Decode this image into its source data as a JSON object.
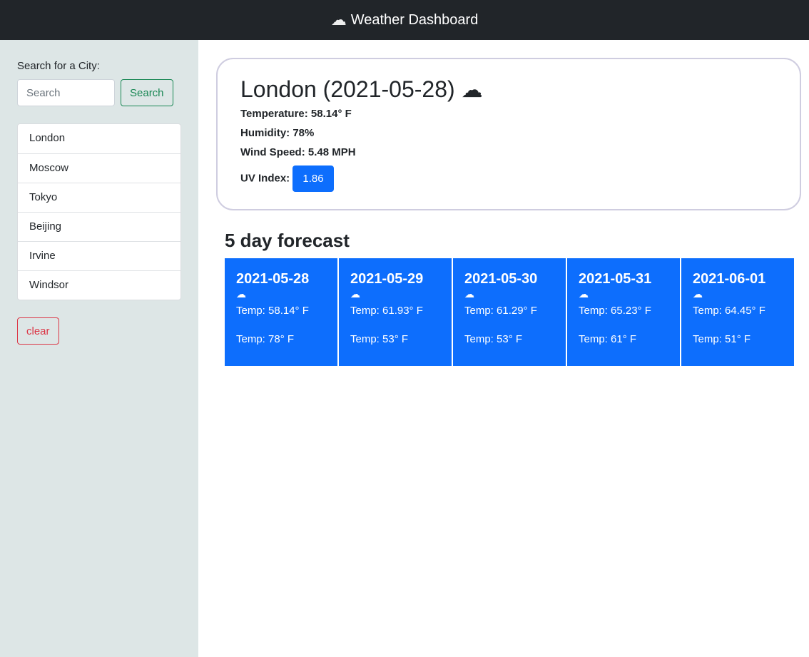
{
  "header": {
    "title": "Weather Dashboard",
    "icon": "cloud-icon"
  },
  "sidebar": {
    "label": "Search for a City:",
    "search_placeholder": "Search",
    "search_button": "Search",
    "cities": [
      "London",
      "Moscow",
      "Tokyo",
      "Beijing",
      "Irvine",
      "Windsor"
    ],
    "clear_button": "clear"
  },
  "current": {
    "title": "London (2021-05-28)",
    "icon": "cloud-icon",
    "temperature": "Temperature: 58.14° F",
    "humidity": "Humidity: 78%",
    "wind": "Wind Speed: 5.48 MPH",
    "uv_label": "UV Index:",
    "uv_value": "1.86",
    "uv_color": "#0d6efd"
  },
  "forecast": {
    "heading": "5 day forecast",
    "days": [
      {
        "date": "2021-05-28",
        "temp": "Temp: 58.14° F",
        "second": "Temp: 78° F"
      },
      {
        "date": "2021-05-29",
        "temp": "Temp: 61.93° F",
        "second": "Temp: 53° F"
      },
      {
        "date": "2021-05-30",
        "temp": "Temp: 61.29° F",
        "second": "Temp: 53° F"
      },
      {
        "date": "2021-05-31",
        "temp": "Temp: 65.23° F",
        "second": "Temp: 61° F"
      },
      {
        "date": "2021-06-01",
        "temp": "Temp: 64.45° F",
        "second": "Temp: 51° F"
      }
    ]
  }
}
